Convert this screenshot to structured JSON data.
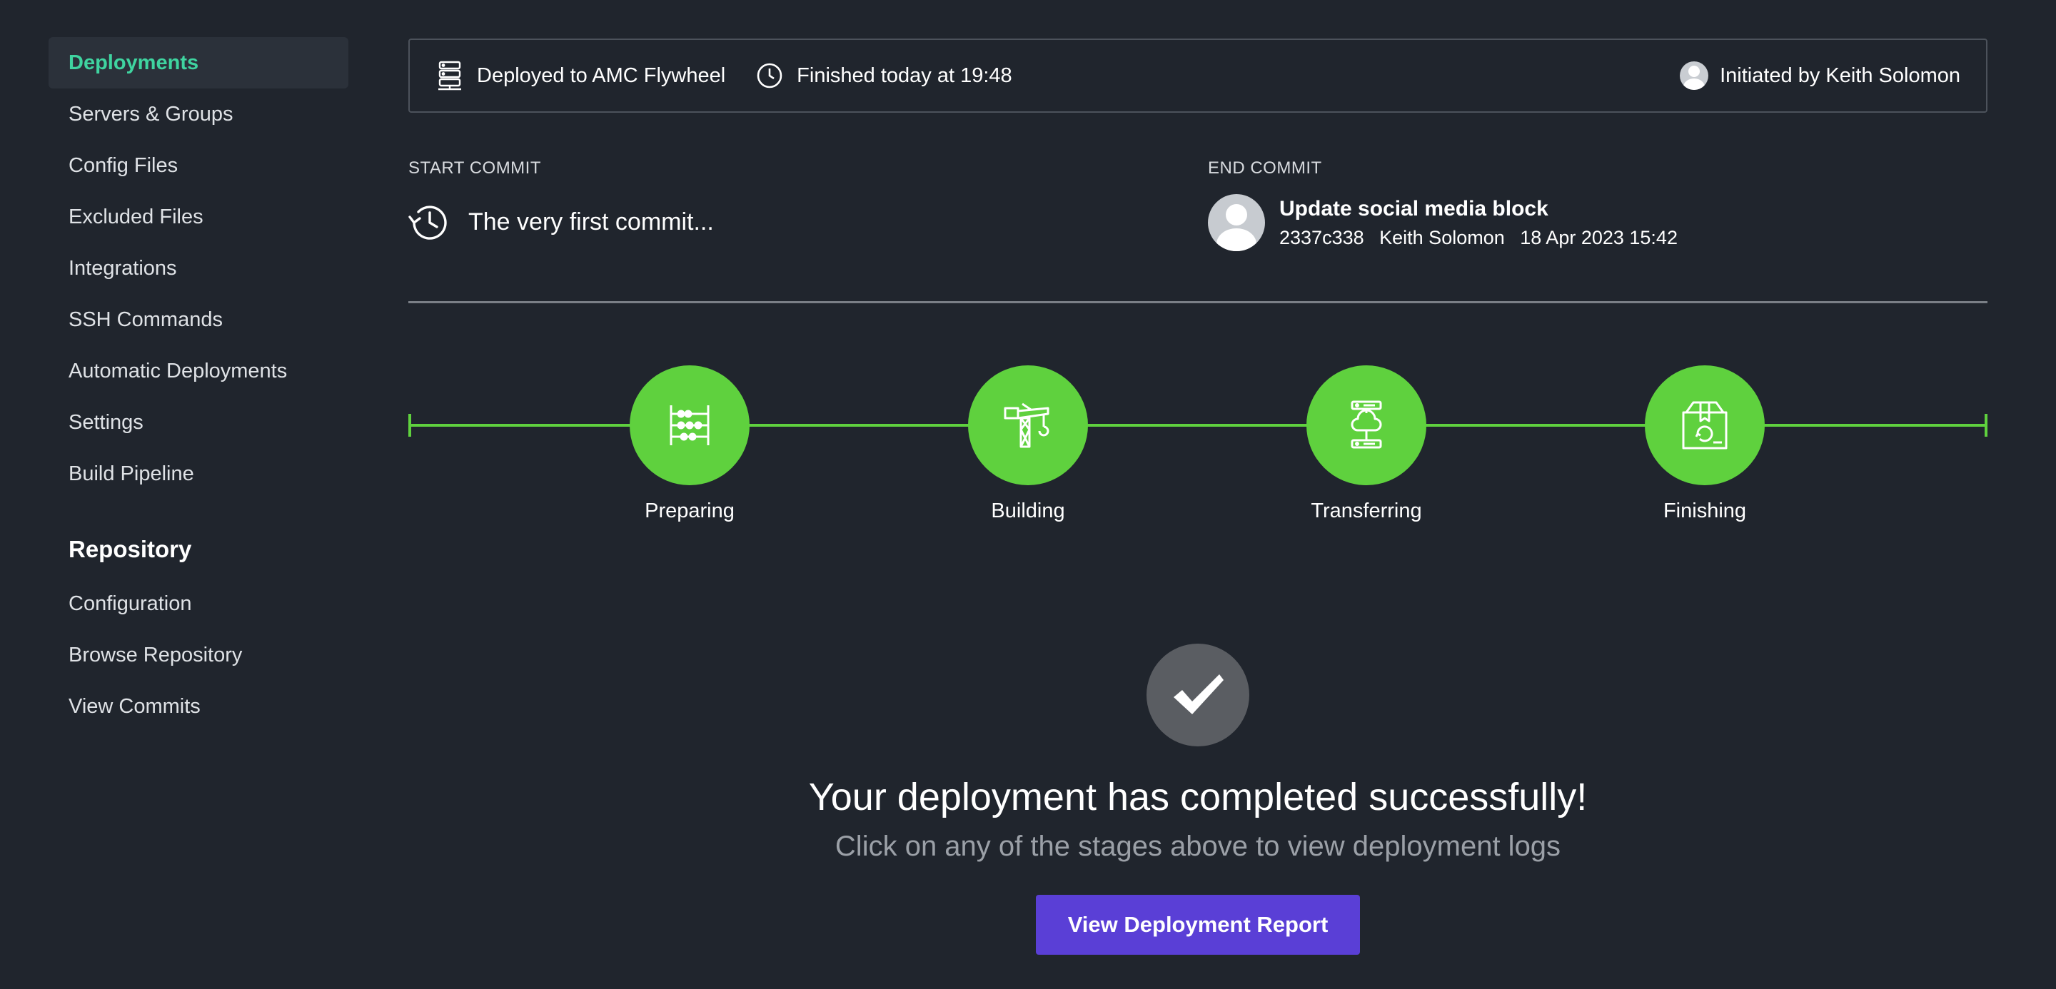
{
  "sidebar": {
    "items": [
      {
        "label": "Deployments",
        "active": true
      },
      {
        "label": "Servers & Groups"
      },
      {
        "label": "Config Files"
      },
      {
        "label": "Excluded Files"
      },
      {
        "label": "Integrations"
      },
      {
        "label": "SSH Commands"
      },
      {
        "label": "Automatic Deployments"
      },
      {
        "label": "Settings"
      },
      {
        "label": "Build Pipeline"
      }
    ],
    "repository_heading": "Repository",
    "repository_items": [
      {
        "label": "Configuration"
      },
      {
        "label": "Browse Repository"
      },
      {
        "label": "View Commits"
      }
    ]
  },
  "info_bar": {
    "deployed_to": "Deployed to AMC Flywheel",
    "finished": "Finished today at 19:48",
    "initiated_by": "Initiated by Keith Solomon"
  },
  "start_commit": {
    "label": "START COMMIT",
    "text": "The very first commit..."
  },
  "end_commit": {
    "label": "END COMMIT",
    "title": "Update social media block",
    "hash": "2337c338",
    "author": "Keith Solomon",
    "date": "18 Apr 2023 15:42"
  },
  "stages": [
    {
      "label": "Preparing",
      "icon": "abacus-icon"
    },
    {
      "label": "Building",
      "icon": "crane-icon"
    },
    {
      "label": "Transferring",
      "icon": "cloud-server-icon"
    },
    {
      "label": "Finishing",
      "icon": "package-icon"
    }
  ],
  "colors": {
    "background": "#20252d",
    "accent_active": "#3fd4a0",
    "stage_complete": "#5fd13e",
    "button": "#5a3fd6"
  },
  "result": {
    "title": "Your deployment has completed successfully!",
    "subtitle": "Click on any of the stages above to view deployment logs",
    "button_label": "View Deployment Report"
  }
}
